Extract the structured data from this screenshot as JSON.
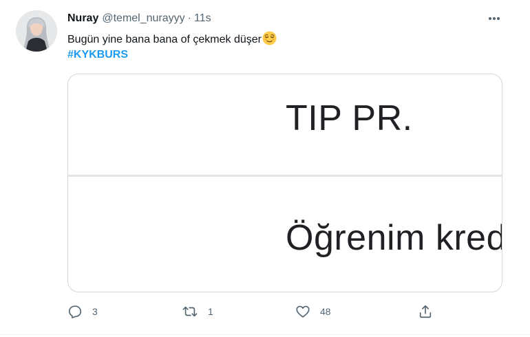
{
  "tweet": {
    "author_name": "Nuray",
    "author_handle": "@temel_nurayyy",
    "separator": "·",
    "timestamp": "11s",
    "text": "Bugün yine bana bana of çekmek düşer",
    "emoji_icon": "relieved-face-emoji",
    "hashtag": "#KYKBURS"
  },
  "media": {
    "line1": "TIP PR.",
    "line2": "Öğrenim kred"
  },
  "actions": {
    "reply_count": "3",
    "retweet_count": "1",
    "like_count": "48"
  },
  "colors": {
    "accent": "#1d9bf0",
    "muted": "#536471",
    "border": "#cfd9de"
  }
}
